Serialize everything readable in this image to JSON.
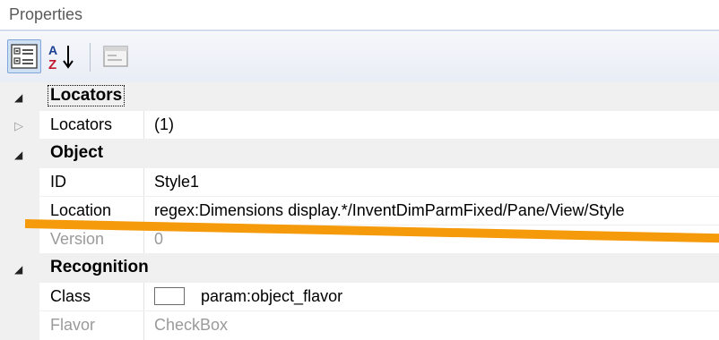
{
  "window": {
    "title": "Properties"
  },
  "toolbar": {
    "buttons": [
      {
        "name": "categorized",
        "icon": "categorized-view-icon",
        "pressed": true
      },
      {
        "name": "alphabetical",
        "icon": "sort-az-icon",
        "pressed": false
      },
      {
        "name": "property-pages",
        "icon": "property-pages-icon",
        "disabled": true
      }
    ]
  },
  "categories": [
    {
      "label": "Locators",
      "expanded": true,
      "properties": [
        {
          "name": "Locators",
          "value": "(1)",
          "expandable": true
        }
      ]
    },
    {
      "label": "Object",
      "expanded": true,
      "properties": [
        {
          "name": "ID",
          "value": "Style1"
        },
        {
          "name": "Location",
          "value": "regex:Dimensions display.*/InventDimParmFixed/Pane/View/Style"
        },
        {
          "name": "Version",
          "value": "0",
          "readonly": true
        }
      ]
    },
    {
      "label": "Recognition",
      "expanded": true,
      "properties": [
        {
          "name": "Class",
          "value": "param:object_flavor",
          "has_checkbox": true
        },
        {
          "name": "Flavor",
          "value": "CheckBox",
          "readonly": true
        }
      ]
    }
  ],
  "colors": {
    "annotation": "#f59a0a",
    "category_bg": "#f0f0f0",
    "toolbar_pressed": "#cfe0f5"
  }
}
